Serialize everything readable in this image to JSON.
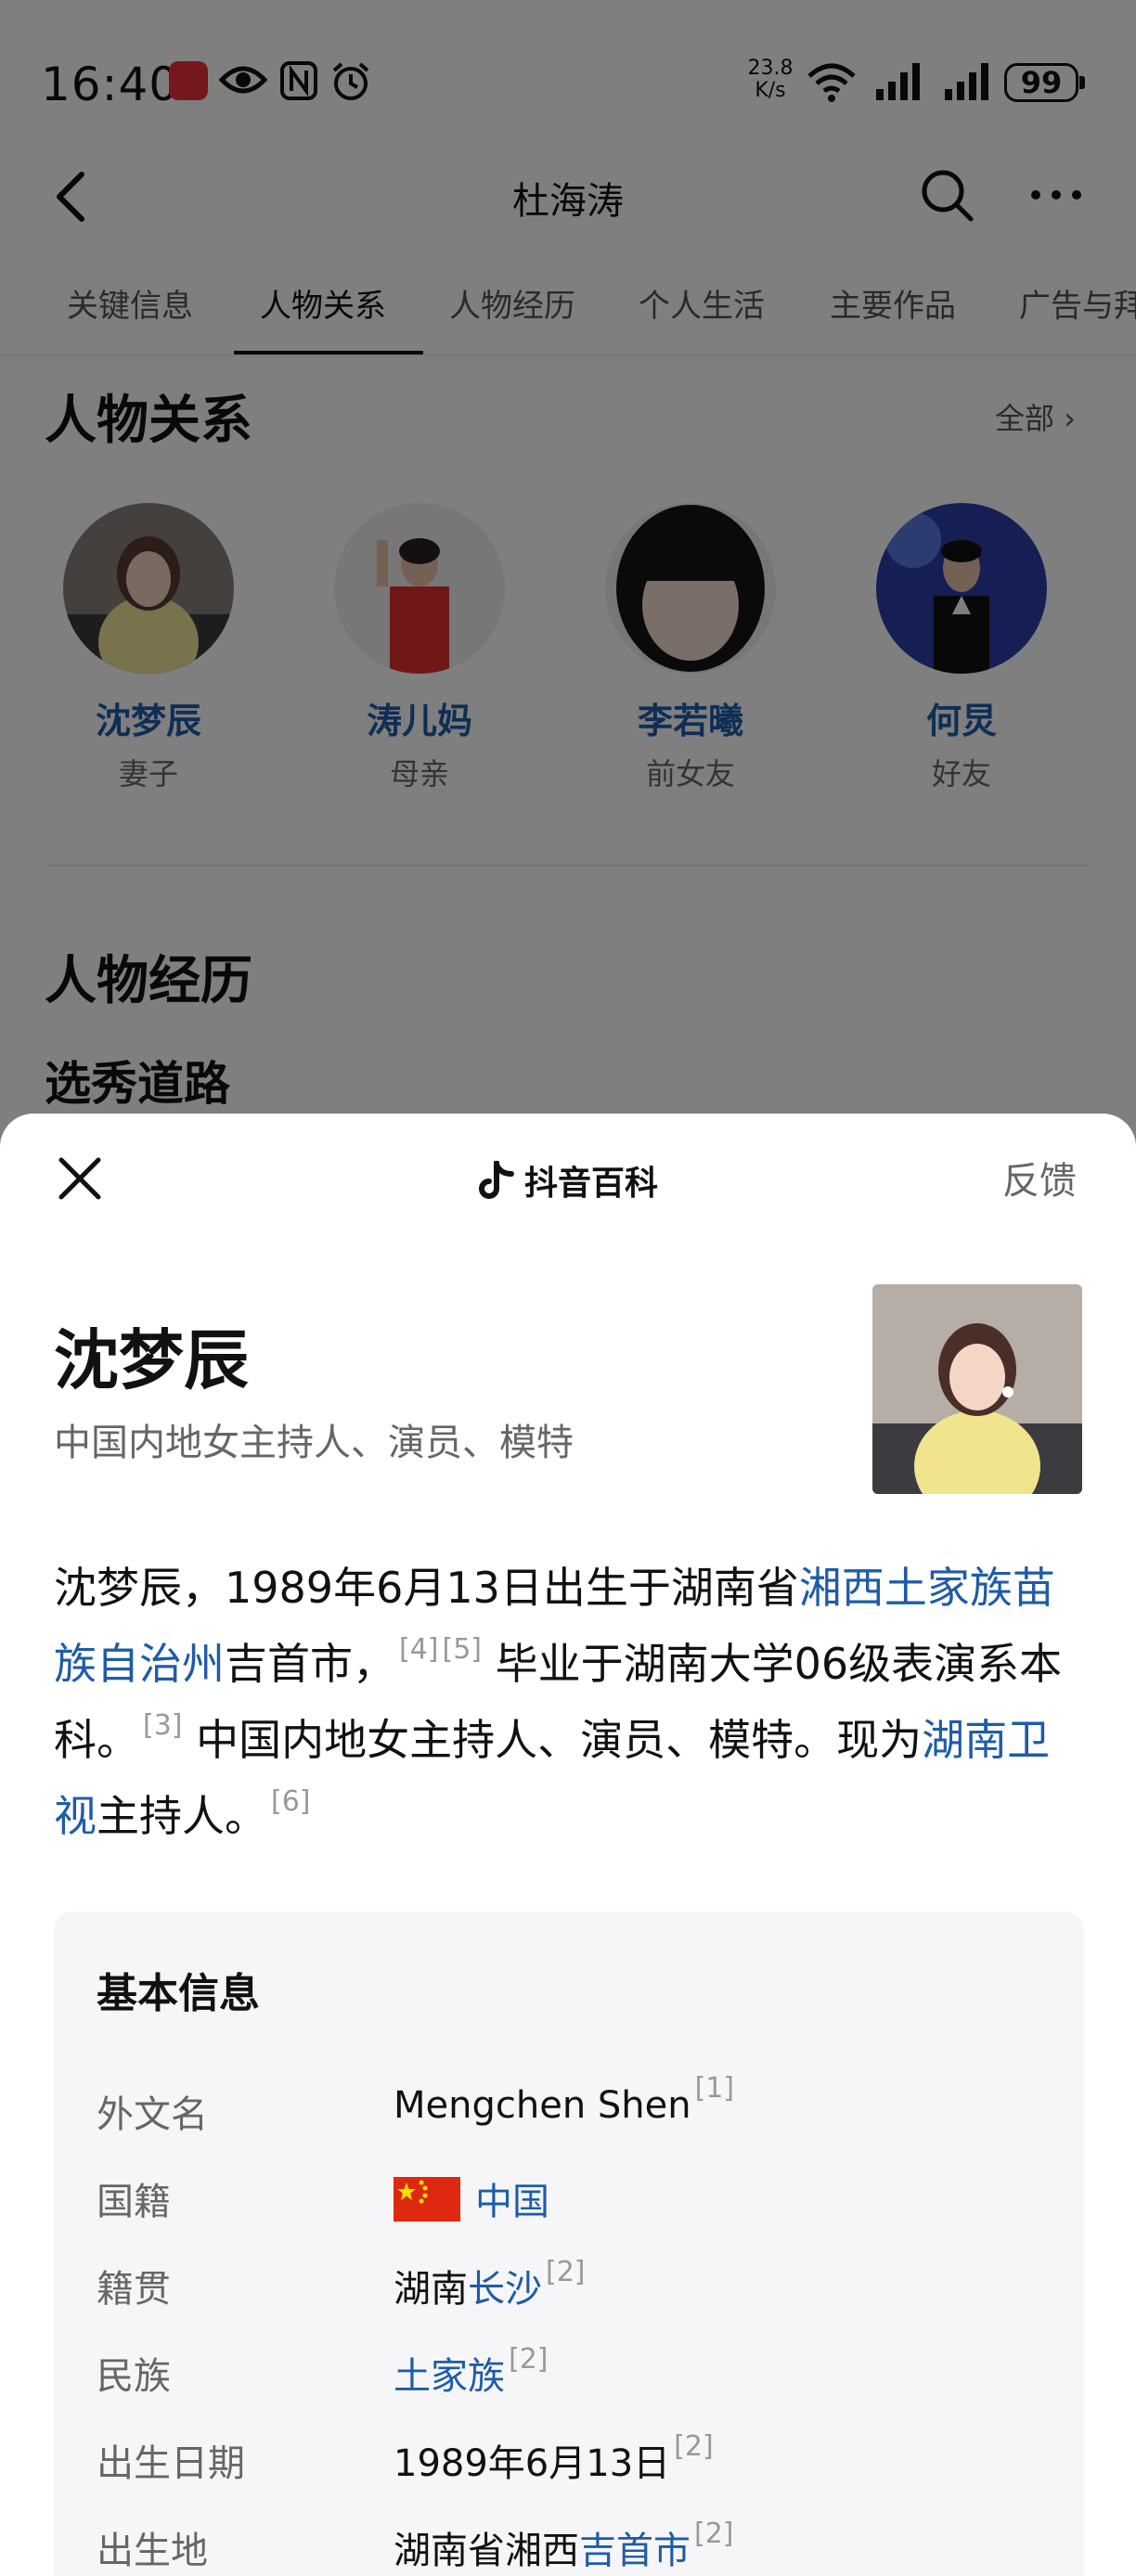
{
  "status_bar": {
    "time": "16:40",
    "speed_value": "23.8",
    "speed_unit": "K/s",
    "battery": "99",
    "icons": [
      "huawei-app-icon",
      "eye-icon",
      "nfc-icon",
      "alarm-icon",
      "wifi-icon",
      "signal-icon",
      "signal-icon",
      "battery-icon"
    ]
  },
  "nav": {
    "title": "杜海涛",
    "back_icon": "chevron-left-icon",
    "search_icon": "search-icon",
    "more_icon": "more-icon"
  },
  "tabs": [
    {
      "label": "关键信息",
      "active": false
    },
    {
      "label": "人物关系",
      "active": true
    },
    {
      "label": "人物经历",
      "active": false
    },
    {
      "label": "个人生活",
      "active": false
    },
    {
      "label": "主要作品",
      "active": false
    },
    {
      "label": "广告与拜",
      "active": false
    }
  ],
  "relations": {
    "title": "人物关系",
    "all_label": "全部",
    "items": [
      {
        "name": "沈梦辰",
        "role": "妻子"
      },
      {
        "name": "涛儿妈",
        "role": "母亲"
      },
      {
        "name": "李若曦",
        "role": "前女友"
      },
      {
        "name": "何炅",
        "role": "好友"
      }
    ]
  },
  "experience": {
    "title": "人物经历",
    "subtitle": "选秀道路"
  },
  "sheet": {
    "brand": "抖音百科",
    "feedback": "反馈",
    "name": "沈梦辰",
    "title": "中国内地女主持人、演员、模特",
    "summary": {
      "p1": "沈梦辰，1989年6月13日出生于湖南省",
      "link1": "湘西土家族苗族自治州",
      "p2": "吉首市，",
      "ref1": "[4]",
      "ref2": "[5]",
      "p3": "毕业于湖南大学06级表演系本科。",
      "ref3": "[3]",
      "p4": "中国内地女主持人、演员、模特。现为",
      "link2": "湖南卫视",
      "p5": "主持人。",
      "ref4": "[6]"
    },
    "info": {
      "title": "基本信息",
      "rows": [
        {
          "key": "外文名",
          "value": "Mengchen Shen",
          "ref": "[1]"
        },
        {
          "key": "国籍",
          "value_link": "中国"
        },
        {
          "key": "籍贯",
          "value": "湖南",
          "value_link": "长沙",
          "ref": "[2]"
        },
        {
          "key": "民族",
          "value_link": "土家族",
          "ref": "[2]"
        },
        {
          "key": "出生日期",
          "value": "1989年6月13日",
          "ref": "[2]"
        },
        {
          "key": "出生地",
          "value": "湖南省湘西",
          "value_link": "吉首市",
          "ref": "[2]"
        }
      ]
    }
  },
  "colors": {
    "link": "#1f5ca8",
    "overlay": "rgba(0,0,0,0.5)",
    "card_bg": "#f6f6f8"
  }
}
